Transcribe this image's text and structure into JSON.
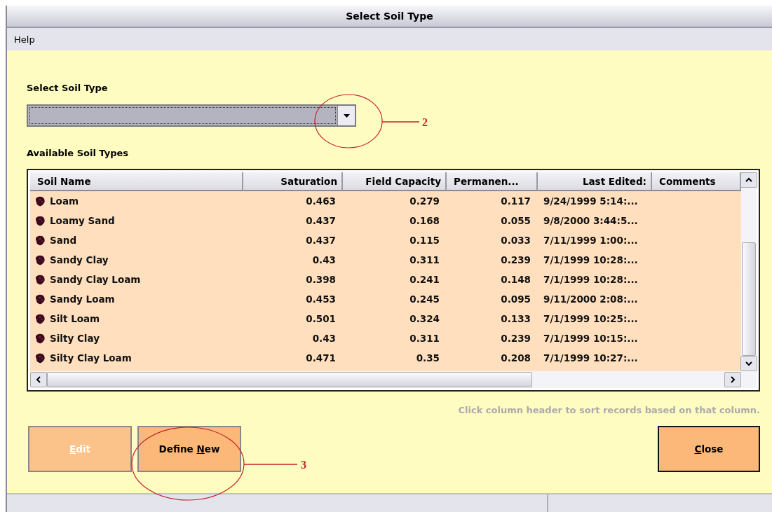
{
  "window": {
    "title": "Select Soil Type"
  },
  "menu": [
    {
      "label": "Help"
    }
  ],
  "select_label": "Select Soil Type",
  "list_label": "Available Soil Types",
  "table": {
    "columns": [
      {
        "label": "Soil Name"
      },
      {
        "label": "Saturation"
      },
      {
        "label": "Field Capacity"
      },
      {
        "label": "Permanen..."
      },
      {
        "label": "Last Edited:"
      },
      {
        "label": "Comments"
      }
    ],
    "rows": [
      {
        "cells": [
          "Loam",
          "0.463",
          "0.279",
          "0.117",
          "9/24/1999 5:14:..."
        ]
      },
      {
        "cells": [
          "Loamy Sand",
          "0.437",
          "0.168",
          "0.055",
          "9/8/2000 3:44:5..."
        ]
      },
      {
        "cells": [
          "Sand",
          "0.437",
          "0.115",
          "0.033",
          "7/11/1999 1:00:..."
        ]
      },
      {
        "cells": [
          "Sandy Clay",
          "0.43",
          "0.311",
          "0.239",
          "7/1/1999 10:28:..."
        ]
      },
      {
        "cells": [
          "Sandy Clay Loam",
          "0.398",
          "0.241",
          "0.148",
          "7/1/1999 10:28:..."
        ]
      },
      {
        "cells": [
          "Sandy Loam",
          "0.453",
          "0.245",
          "0.095",
          "9/11/2000 2:08:..."
        ]
      },
      {
        "cells": [
          "Silt Loam",
          "0.501",
          "0.324",
          "0.133",
          "7/1/1999 10:25:..."
        ]
      },
      {
        "cells": [
          "Silty Clay",
          "0.43",
          "0.311",
          "0.239",
          "7/1/1999 10:15:..."
        ]
      },
      {
        "cells": [
          "Silty Clay Loam",
          "0.471",
          "0.35",
          "0.208",
          "7/1/1999 10:27:..."
        ]
      }
    ]
  },
  "hint": "Click column header to sort records based on that column.",
  "buttons": [
    {
      "key": "E",
      "after": "dit",
      "disabled": true
    },
    {
      "before": "Define ",
      "key": "N",
      "after": "ew",
      "disabled": false
    }
  ],
  "close_button": {
    "key": "C",
    "after": "lose"
  },
  "annotations": [
    {
      "label": "2"
    },
    {
      "label": "3"
    }
  ]
}
